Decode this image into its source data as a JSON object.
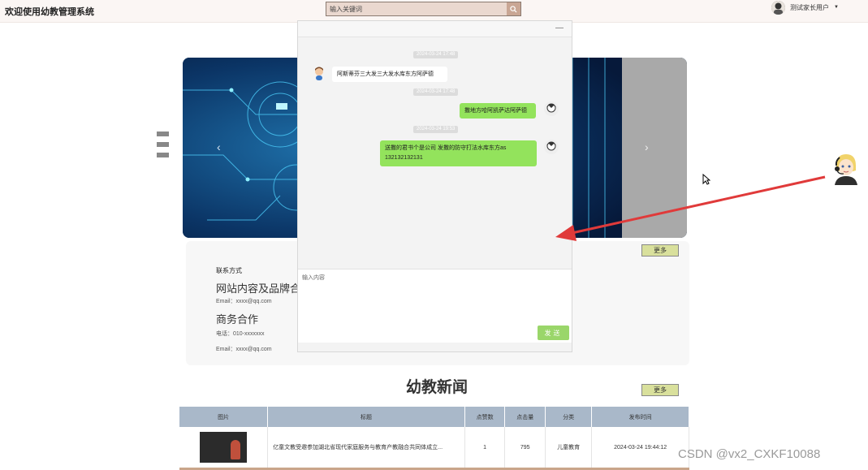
{
  "header": {
    "site_title": "欢迎使用幼教管理系统",
    "search_placeholder": "输入关键词",
    "user_name": "测试家长用户"
  },
  "banner": {
    "prev_label": "‹",
    "next_label": "›"
  },
  "contact": {
    "heading": "联系方式",
    "block1_title": "网站内容及品牌合",
    "block1_email": "Email：xxxx@qq.com",
    "block2_title": "商务合作",
    "block2_phone": "电话：010-xxxxxxx",
    "block2_email": "Email：xxxx@qq.com",
    "more_label": "更多"
  },
  "news": {
    "title": "幼教新闻",
    "more_label": "更多",
    "columns": [
      "图片",
      "标题",
      "点赞数",
      "点击量",
      "分类",
      "发布时间"
    ],
    "rows": [
      {
        "title": "亿童文教受邀参加湖北省现代家庭服务与教育产教融合共同体成立...",
        "likes": "1",
        "views": "795",
        "category": "儿童教育",
        "published": "2024-03-24 19:44:12"
      }
    ]
  },
  "chat": {
    "minimize_label": "—",
    "input_placeholder": "输入内容",
    "send_label": "发送",
    "messages": [
      {
        "time": "2024-03-24 17:48",
        "side": "left",
        "text": "阿斯蒂芬三大发三大发水库东方阿萨德"
      },
      {
        "time": "2024-03-24 17:48",
        "side": "right",
        "text": "撒地方哈阿凯萨达阿萨德"
      },
      {
        "time": "2024-03-24 19:53",
        "side": "right",
        "text": "送撒的君书个是公司 发撒的防守打法水库东方as 132132132131"
      }
    ]
  },
  "watermark": "CSDN @vx2_CXKF10088",
  "colors": {
    "send_green": "#9ad66a",
    "bubble_green": "#93e35c",
    "header_bg": "#fbf6f4",
    "table_header": "#a9b8c9",
    "arrow_red": "#e03a3a"
  }
}
